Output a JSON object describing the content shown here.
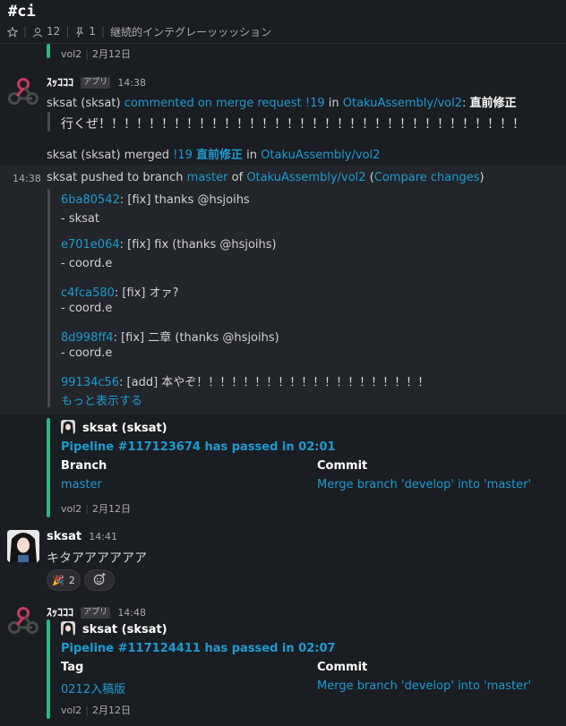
{
  "header": {
    "channel": "#ci",
    "members": "12",
    "pins": "1",
    "topic": "継続的インテグレーッッッション"
  },
  "top_footer": {
    "repo": "vol2",
    "date": "2月12日"
  },
  "msg1": {
    "sender": "ｽｯｺｺｺ",
    "badge": "アプリ",
    "time": "14:38",
    "line1_user": "sksat (sksat)",
    "line1_action": "commented on merge request !19",
    "line1_in": "in",
    "line1_repo": "OtakuAssembly/vol2",
    "line1_colon": ":",
    "line1_title": "直前修正",
    "quote": "行くぜ！！！！！！！！！！！！！！！！！！！！！！！！！！！！！！！！！！",
    "line2_user": "sksat (sksat) merged",
    "line2_mr": "!19",
    "line2_title": "直前修正",
    "line2_in": "in",
    "line2_repo": "OtakuAssembly/vol2"
  },
  "push": {
    "time": "14:38",
    "text_pre": "sksat pushed to branch",
    "branch": "master",
    "of": "of",
    "repo": "OtakuAssembly/vol2",
    "compare": "Compare changes",
    "open_paren": "(",
    "close_paren": ")",
    "commits": [
      {
        "sha": "6ba80542",
        "msg": ": [fix] thanks @hsjoihs",
        "author": "- sksat"
      },
      {
        "sha": "e701e064",
        "msg": ": [fix] fix (thanks @hsjoihs)",
        "author": "- coord.e"
      },
      {
        "sha": "c4fca580",
        "msg": ": [fix] オァ?",
        "author": "- coord.e"
      },
      {
        "sha": "8d998ff4",
        "msg": ": [fix] 二章 (thanks @hsjoihs)",
        "author": "- coord.e"
      },
      {
        "sha": "99134c56",
        "msg": ": [add] 本やぞ！！！！！！！！！！！！！！！！！！！！",
        "author": ""
      }
    ],
    "show_more": "もっと表示する"
  },
  "pipeline1": {
    "author": "sksat (sksat)",
    "title": "Pipeline #117123674 has passed in 02:01",
    "field1_label": "Branch",
    "field1_value": "master",
    "field2_label": "Commit",
    "field2_value": "Merge branch 'develop' into 'master'",
    "footer_repo": "vol2",
    "footer_date": "2月12日"
  },
  "msg2": {
    "sender": "sksat",
    "time": "14:41",
    "text": "キタアアアアアア",
    "reaction_emoji": "🎉",
    "reaction_count": "2"
  },
  "msg3": {
    "sender": "ｽｯｺｺｺ",
    "badge": "アプリ",
    "time": "14:48",
    "author": "sksat (sksat)",
    "title": "Pipeline #117124411 has passed in 02:07",
    "field1_label": "Tag",
    "field1_value": "0212入稿版",
    "field2_label": "Commit",
    "field2_value": "Merge branch 'develop' into 'master'",
    "footer_repo": "vol2",
    "footer_date": "2月12日"
  },
  "colors": {
    "background": "#1a1d21",
    "link": "#1d9bd1",
    "green_bar": "#2eb67d",
    "gray_bar": "#4a4b4e"
  }
}
